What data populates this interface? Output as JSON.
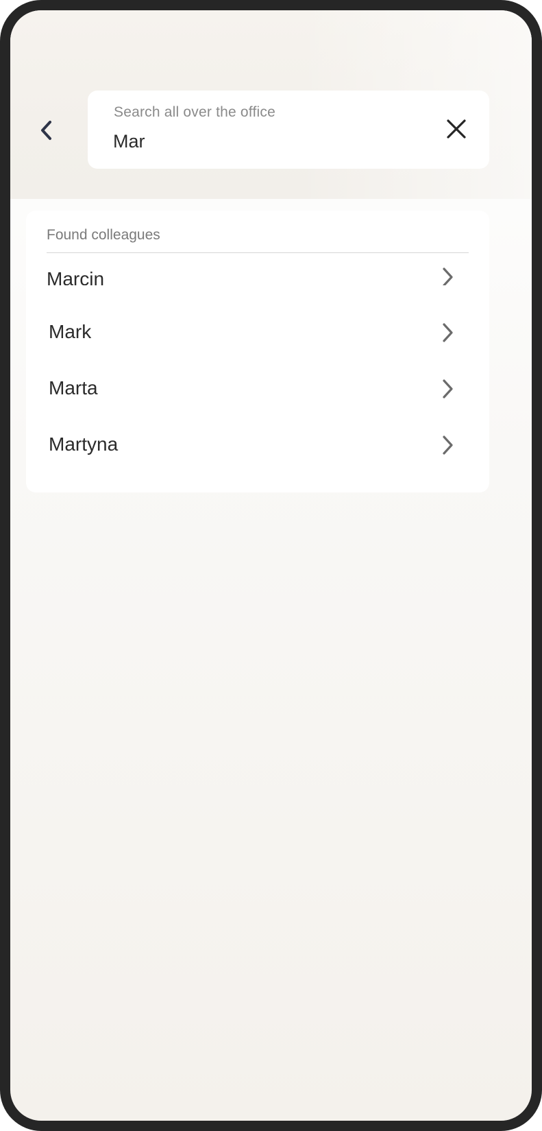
{
  "search": {
    "placeholder": "Search all over the office",
    "query": "Mar"
  },
  "results": {
    "header": "Found colleagues",
    "items": [
      {
        "name": "Marcin"
      },
      {
        "name": "Mark"
      },
      {
        "name": "Marta"
      },
      {
        "name": "Martyna"
      }
    ]
  },
  "icons": {
    "back": "chevron-left-icon",
    "clear": "close-icon",
    "row": "chevron-right-icon"
  },
  "colors": {
    "frame": "#262626",
    "icon_dark": "#2e3448",
    "chevron": "#6b6b6b",
    "text": "#2b2b2b"
  }
}
